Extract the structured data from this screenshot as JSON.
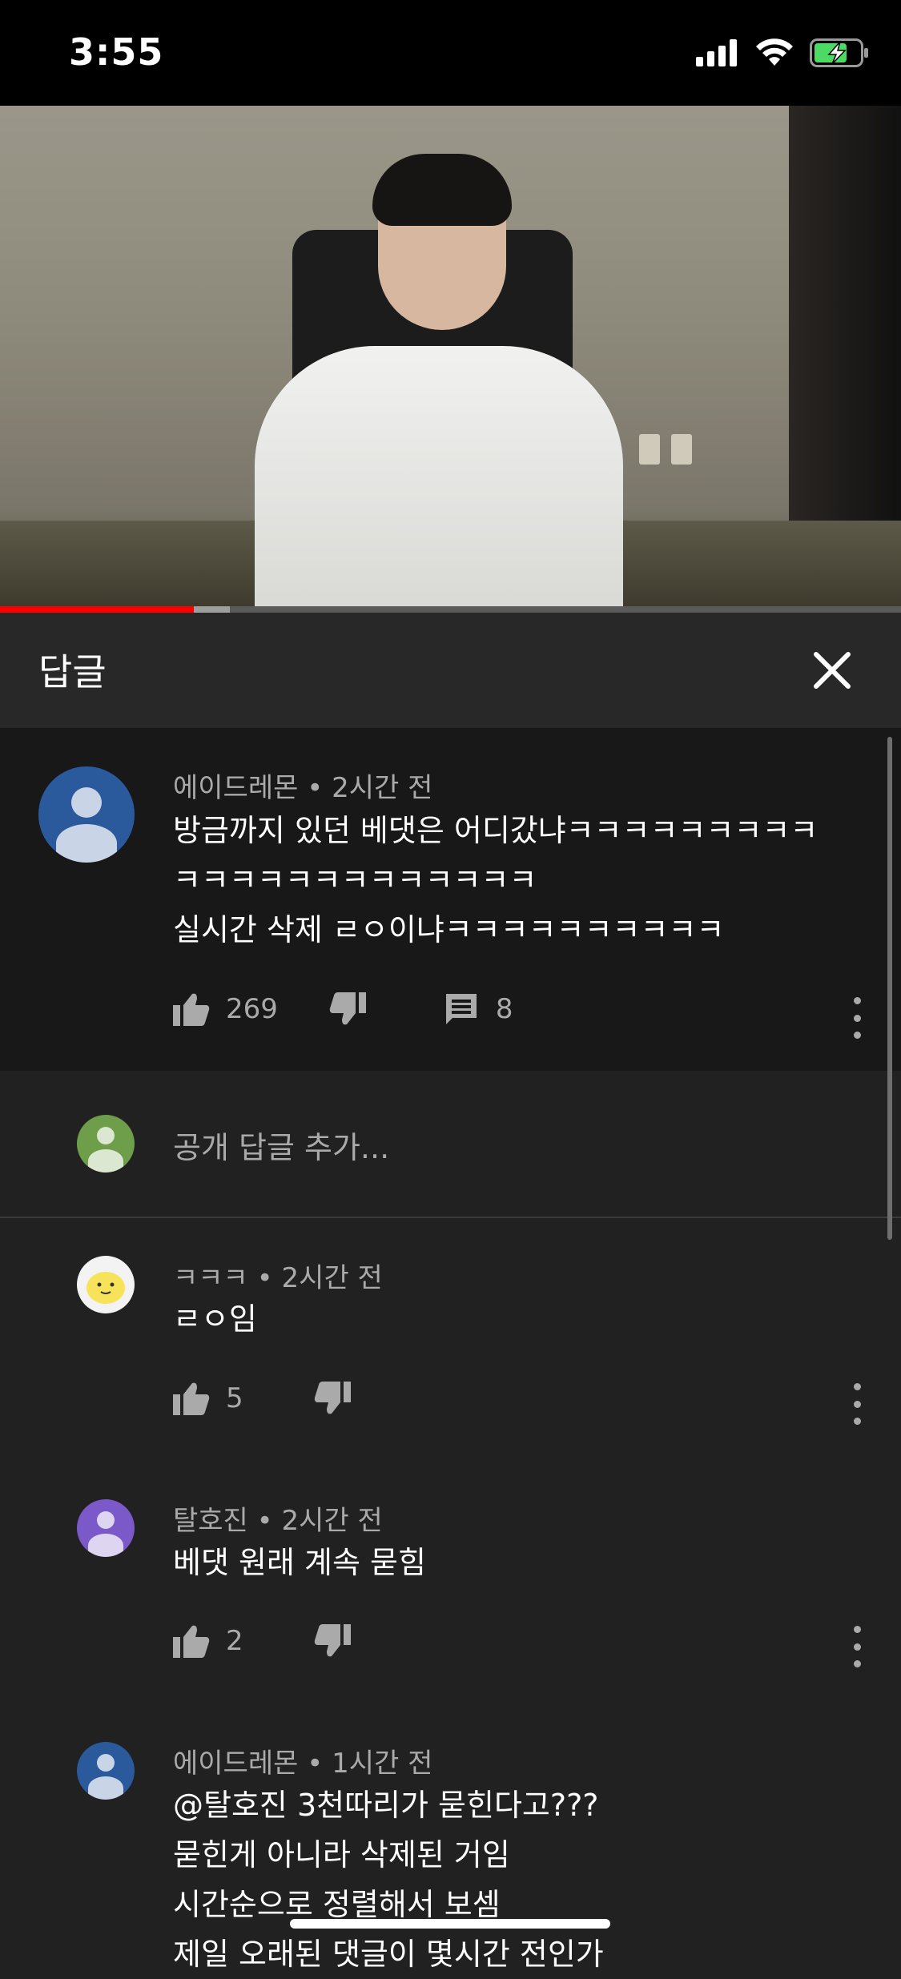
{
  "status_bar": {
    "time": "3:55"
  },
  "video": {
    "progress_played": 0.215,
    "progress_buffered": 0.255
  },
  "replies_panel": {
    "title": "답글",
    "add_reply_placeholder": "공개 답글 추가..."
  },
  "parent_comment": {
    "author": "에이드레몬",
    "time": "2시간 전",
    "lines": [
      "방금까지 있던 베댓은 어디갔냐ㅋㅋㅋㅋㅋㅋㅋㅋㅋ",
      "ㅋㅋㅋㅋㅋㅋㅋㅋㅋㅋㅋㅋㅋ",
      "실시간 삭제 ㄹㅇ이냐ㅋㅋㅋㅋㅋㅋㅋㅋㅋㅋ"
    ],
    "likes": "269",
    "reply_count": "8",
    "avatar_color": "#2a5a9c"
  },
  "replies": [
    {
      "author": "ㅋㅋㅋ",
      "time": "2시간 전",
      "lines": [
        "ㄹㅇ임"
      ],
      "likes": "5",
      "avatar_color": "#f3f3f3"
    },
    {
      "author": "탈호진",
      "time": "2시간 전",
      "lines": [
        "베댓 원래 계속 묻힘"
      ],
      "likes": "2",
      "avatar_color": "#7b59c8"
    },
    {
      "author": "에이드레몬",
      "time": "1시간 전",
      "lines": [
        "@탈호진 3천따리가 묻힌다고???",
        "묻힌게 아니라 삭제된 거임",
        "시간순으로 정렬해서 보셈",
        "제일 오래된 댓글이 몇시간 전인가"
      ],
      "avatar_color": "#2a5a9c"
    }
  ],
  "colors": {
    "progress_red": "#ff0000",
    "panel_header": "#282828",
    "parent_bg": "#181818",
    "list_bg": "#212121",
    "self_avatar": "#6f9e4a"
  },
  "icons": [
    "signal-icon",
    "wifi-icon",
    "battery-charging-icon",
    "close-icon",
    "thumb-up-icon",
    "thumb-down-icon",
    "reply-comment-icon",
    "more-vert-icon"
  ]
}
